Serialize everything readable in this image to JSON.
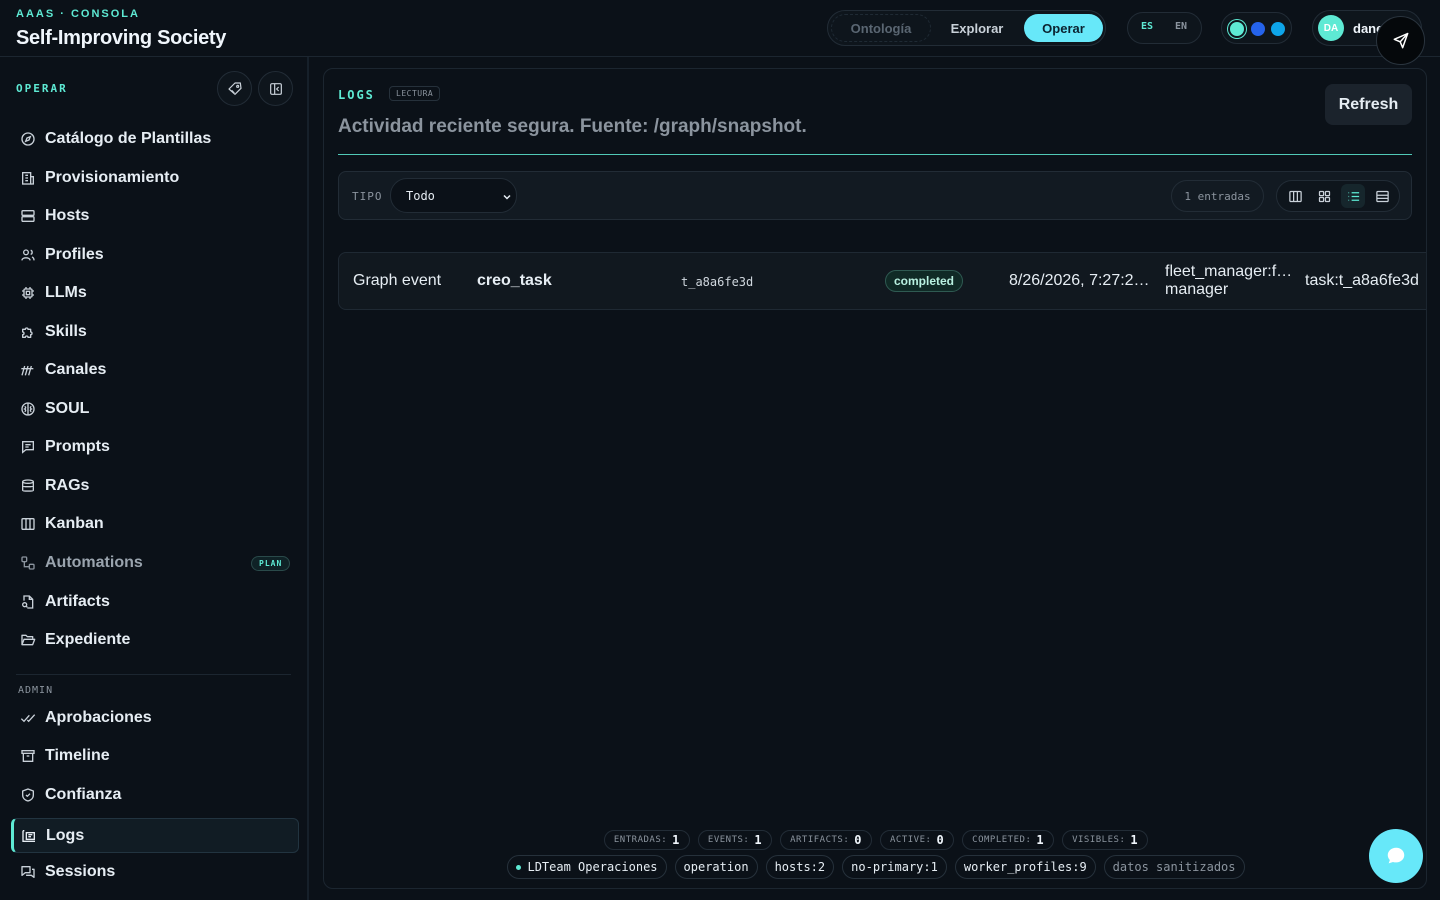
{
  "header": {
    "kicker": "AAAS · CONSOLA",
    "title": "Self-Improving Society",
    "modes": [
      "Ontología",
      "Explorar",
      "Operar"
    ],
    "active_mode": "Operar",
    "languages": [
      "ES",
      "EN"
    ],
    "active_language": "ES",
    "user": {
      "initials": "DA",
      "name": "dane"
    },
    "theme_colors": [
      "#5eead4",
      "#2563eb",
      "#0ea5e9"
    ],
    "accent_color": "#5eead4"
  },
  "sidebar": {
    "heading": "OPERAR",
    "items": [
      {
        "label": "Catálogo de Plantillas",
        "icon": "compass-icon"
      },
      {
        "label": "Provisionamiento",
        "icon": "building-icon"
      },
      {
        "label": "Hosts",
        "icon": "server-icon"
      },
      {
        "label": "Profiles",
        "icon": "users-icon"
      },
      {
        "label": "LLMs",
        "icon": "chip-icon"
      },
      {
        "label": "Skills",
        "icon": "puzzle-icon"
      },
      {
        "label": "Canales",
        "icon": "antenna-icon"
      },
      {
        "label": "SOUL",
        "icon": "brain-icon"
      },
      {
        "label": "Prompts",
        "icon": "message-square-icon"
      },
      {
        "label": "RAGs",
        "icon": "database-icon"
      },
      {
        "label": "Kanban",
        "icon": "columns-icon"
      },
      {
        "label": "Automations",
        "icon": "workflow-icon",
        "badge": "PLAN"
      },
      {
        "label": "Artifacts",
        "icon": "file-search-icon"
      },
      {
        "label": "Expediente",
        "icon": "folder-open-icon"
      }
    ],
    "admin_heading": "ADMIN",
    "admin_items": [
      {
        "label": "Aprobaciones",
        "icon": "double-check-icon"
      },
      {
        "label": "Timeline",
        "icon": "archive-icon"
      },
      {
        "label": "Confianza",
        "icon": "shield-check-icon"
      },
      {
        "label": "Logs",
        "icon": "logs-icon",
        "active": true
      },
      {
        "label": "Sessions",
        "icon": "chat-bubbles-icon"
      }
    ]
  },
  "main": {
    "title": "LOGS",
    "badge": "LECTURA",
    "subtitle": "Actividad reciente segura. Fuente: /graph/snapshot.",
    "refresh_label": "Refresh",
    "filter": {
      "label": "TIPO",
      "selected": "Todo"
    },
    "entries_count": "1 entradas",
    "view_modes": [
      "columns",
      "grid",
      "list",
      "table"
    ],
    "active_view": "list",
    "rows": [
      {
        "type": "Graph event",
        "name": "creo_task",
        "id": "t_a8a6fe3d",
        "status": "completed",
        "date": "8/26/2026, 7:27:2…",
        "actor_line1": "fleet_manager:f…",
        "actor_line2": "manager",
        "ref": "task:t_a8a6fe3d"
      }
    ],
    "stats": [
      {
        "label": "ENTRADAS:",
        "value": "1"
      },
      {
        "label": "EVENTS:",
        "value": "1"
      },
      {
        "label": "ARTIFACTS:",
        "value": "0"
      },
      {
        "label": "ACTIVE:",
        "value": "0"
      },
      {
        "label": "COMPLETED:",
        "value": "1"
      },
      {
        "label": "VISIBLES:",
        "value": "1"
      }
    ],
    "tags": [
      "LDTeam Operaciones",
      "operation",
      "hosts:2",
      "no-primary:1",
      "worker_profiles:9",
      "datos sanitizados"
    ]
  }
}
